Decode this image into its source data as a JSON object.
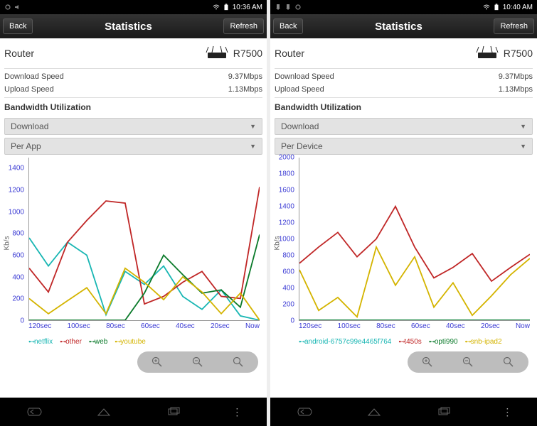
{
  "left": {
    "status_time": "10:36 AM",
    "header_back": "Back",
    "header_title": "Statistics",
    "header_refresh": "Refresh",
    "router_label": "Router",
    "router_model": "R7500",
    "download_speed_label": "Download Speed",
    "download_speed_value": "9.37Mbps",
    "upload_speed_label": "Upload Speed",
    "upload_speed_value": "1.13Mbps",
    "bw_util_label": "Bandwidth Utilization",
    "dd1": "Download",
    "dd2": "Per App",
    "ylabel": "Kb/s",
    "xticks": [
      "120sec",
      "100sec",
      "80sec",
      "60sec",
      "40sec",
      "20sec",
      "Now"
    ],
    "legend": [
      {
        "name": "netflix",
        "color": "#18b6b3"
      },
      {
        "name": "other",
        "color": "#c02727"
      },
      {
        "name": "web",
        "color": "#0a7a2a"
      },
      {
        "name": "youtube",
        "color": "#d4b400"
      }
    ]
  },
  "right": {
    "status_time": "10:40 AM",
    "header_back": "Back",
    "header_title": "Statistics",
    "header_refresh": "Refresh",
    "router_label": "Router",
    "router_model": "R7500",
    "download_speed_label": "Download Speed",
    "download_speed_value": "9.37Mbps",
    "upload_speed_label": "Upload Speed",
    "upload_speed_value": "1.13Mbps",
    "bw_util_label": "Bandwidth Utilization",
    "dd1": "Download",
    "dd2": "Per Device",
    "ylabel": "Kb/s",
    "xticks": [
      "120sec",
      "100sec",
      "80sec",
      "60sec",
      "40sec",
      "20sec",
      "Now"
    ],
    "legend": [
      {
        "name": "android-6757c99e4465f764",
        "color": "#18b6b3"
      },
      {
        "name": "t450s",
        "color": "#c02727"
      },
      {
        "name": "opti990",
        "color": "#0a7a2a"
      },
      {
        "name": "snb-ipad2",
        "color": "#d4b400"
      }
    ]
  },
  "chart_data": [
    {
      "type": "line",
      "title": "Bandwidth Utilization — Download — Per App",
      "xlabel": "",
      "ylabel": "Kb/s",
      "ylim": [
        0,
        1500
      ],
      "x": [
        120,
        110,
        100,
        90,
        80,
        70,
        60,
        50,
        40,
        30,
        20,
        10,
        0
      ],
      "series": [
        {
          "name": "netflix",
          "color": "#18b6b3",
          "values": [
            760,
            500,
            720,
            600,
            50,
            450,
            330,
            500,
            220,
            100,
            280,
            40,
            0
          ]
        },
        {
          "name": "other",
          "color": "#c02727",
          "values": [
            480,
            260,
            720,
            920,
            1100,
            1080,
            150,
            220,
            350,
            450,
            220,
            200,
            1230
          ]
        },
        {
          "name": "web",
          "color": "#0a7a2a",
          "values": [
            0,
            0,
            0,
            0,
            0,
            0,
            250,
            600,
            420,
            250,
            280,
            120,
            790
          ]
        },
        {
          "name": "youtube",
          "color": "#d4b400",
          "values": [
            200,
            60,
            180,
            300,
            60,
            480,
            350,
            190,
            400,
            260,
            60,
            250,
            0
          ]
        }
      ],
      "xticks": [
        "120sec",
        "100sec",
        "80sec",
        "60sec",
        "40sec",
        "20sec",
        "Now"
      ]
    },
    {
      "type": "line",
      "title": "Bandwidth Utilization — Download — Per Device",
      "xlabel": "",
      "ylabel": "Kb/s",
      "ylim": [
        0,
        2000
      ],
      "x": [
        120,
        110,
        100,
        90,
        80,
        70,
        60,
        50,
        40,
        30,
        20,
        10,
        0
      ],
      "series": [
        {
          "name": "android-6757c99e4465f764",
          "color": "#18b6b3",
          "values": [
            0,
            0,
            0,
            0,
            0,
            0,
            0,
            0,
            0,
            0,
            0,
            0,
            0
          ]
        },
        {
          "name": "t450s",
          "color": "#c02727",
          "values": [
            700,
            900,
            1080,
            780,
            1000,
            1400,
            900,
            520,
            650,
            820,
            480,
            650,
            810
          ]
        },
        {
          "name": "opti990",
          "color": "#0a7a2a",
          "values": [
            0,
            0,
            0,
            0,
            0,
            0,
            0,
            0,
            0,
            0,
            0,
            0,
            0
          ]
        },
        {
          "name": "snb-ipad2",
          "color": "#d4b400",
          "values": [
            620,
            120,
            280,
            40,
            900,
            430,
            780,
            160,
            460,
            60,
            300,
            560,
            760
          ]
        }
      ],
      "xticks": [
        "120sec",
        "100sec",
        "80sec",
        "60sec",
        "40sec",
        "20sec",
        "Now"
      ]
    }
  ]
}
